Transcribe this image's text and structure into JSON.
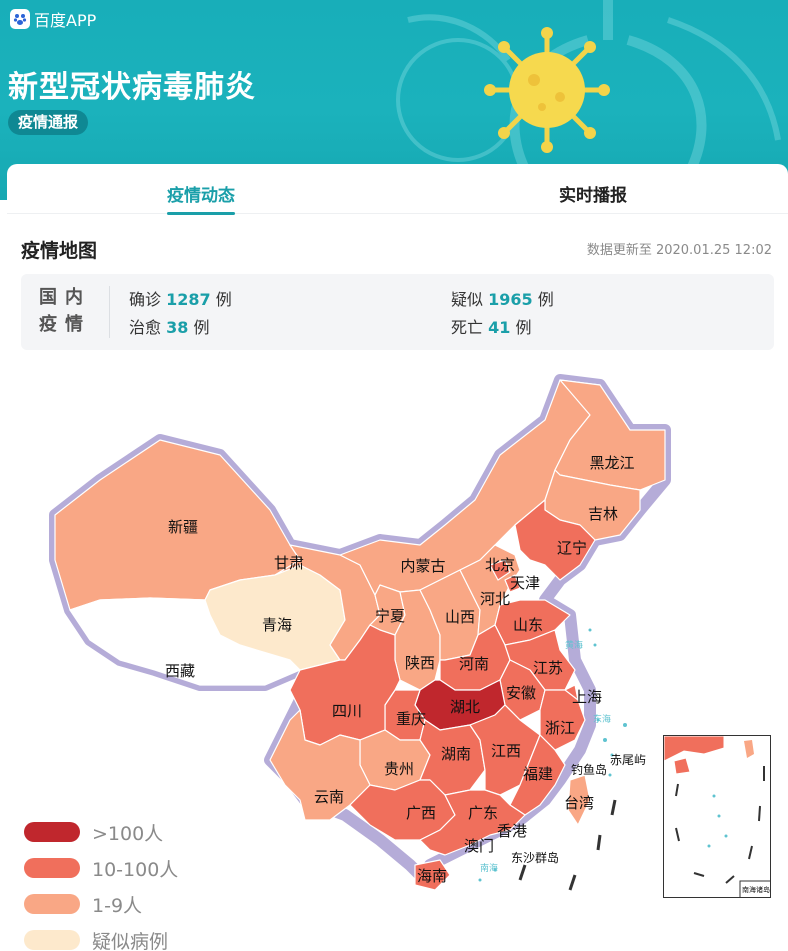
{
  "header": {
    "brand": "百度APP",
    "title": "新型冠状病毒肺炎",
    "tag": "疫情通报"
  },
  "tabs": [
    {
      "label": "疫情动态",
      "active": true
    },
    {
      "label": "实时播报",
      "active": false
    }
  ],
  "section": {
    "title": "疫情地图",
    "updated": "数据更新至 2020.01.25 12:02"
  },
  "domestic": {
    "label_line1": "国内",
    "label_line2": "疫情",
    "confirmed": {
      "label": "确诊",
      "value": "1287",
      "unit": "例"
    },
    "suspected": {
      "label": "疑似",
      "value": "1965",
      "unit": "例"
    },
    "cured": {
      "label": "治愈",
      "value": "38",
      "unit": "例"
    },
    "deaths": {
      "label": "死亡",
      "value": "41",
      "unit": "例"
    }
  },
  "map": {
    "provinces": [
      "新疆",
      "西藏",
      "青海",
      "甘肃",
      "内蒙古",
      "宁夏",
      "陕西",
      "山西",
      "河北",
      "北京",
      "天津",
      "辽宁",
      "吉林",
      "黑龙江",
      "山东",
      "河南",
      "江苏",
      "安徽",
      "上海",
      "湖北",
      "重庆",
      "四川",
      "贵州",
      "云南",
      "湖南",
      "江西",
      "浙江",
      "福建",
      "广西",
      "广东",
      "海南",
      "台湾",
      "香港",
      "澳门"
    ],
    "extra_labels": {
      "dy": "钓鱼岛",
      "cwy": "赤尾屿",
      "ds": "东沙群岛",
      "sea1": "黄海",
      "sea2": "东海",
      "sea3": "南海"
    },
    "inset_title": "南海诸岛"
  },
  "legend": [
    {
      "label": ">100人",
      "color": "#c0272d"
    },
    {
      "label": "10-100人",
      "color": "#f06f5c"
    },
    {
      "label": "1-9人",
      "color": "#f9a785"
    },
    {
      "label": "疑似病例",
      "color": "#fde9cc"
    }
  ],
  "colors": {
    "accent": "#1a9fa9",
    "header": "#18aeb9",
    "level4": "#c0272d",
    "level3": "#f06f5c",
    "level2": "#f9a785",
    "level1": "#fde9cc"
  }
}
